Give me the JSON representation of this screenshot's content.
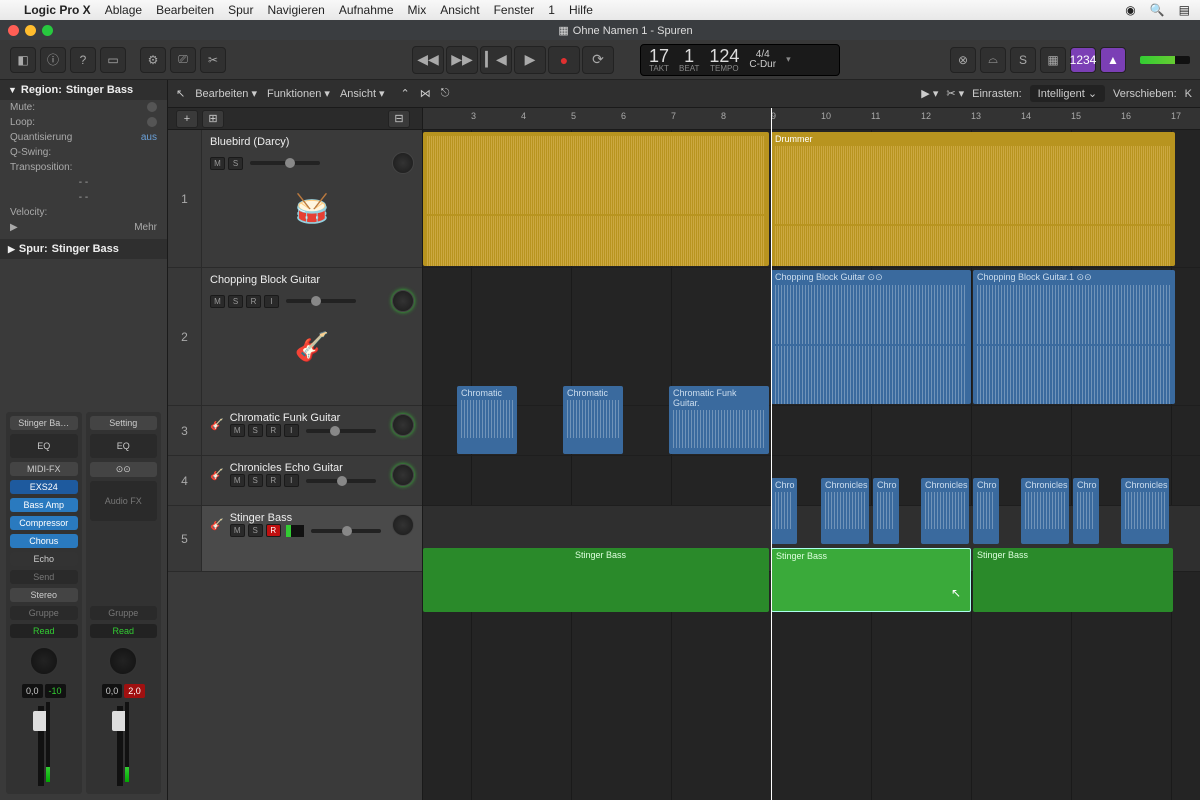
{
  "menubar": {
    "app": "Logic Pro X",
    "items": [
      "Ablage",
      "Bearbeiten",
      "Spur",
      "Navigieren",
      "Aufnahme",
      "Mix",
      "Ansicht",
      "Fenster",
      "1",
      "Hilfe"
    ]
  },
  "window_title": "Ohne Namen 1 - Spuren",
  "lcd": {
    "bars": "17",
    "beat": "1",
    "beat_label": "BEAT",
    "bars_label": "TAKT",
    "tempo": "124",
    "tempo_label": "TEMPO",
    "sig": "4/4",
    "key": "C-Dur"
  },
  "track_toolbar": {
    "menus": [
      "Bearbeiten",
      "Funktionen",
      "Ansicht"
    ],
    "snap_label": "Einrasten:",
    "snap_value": "Intelligent",
    "move_label": "Verschieben:",
    "move_value": "K"
  },
  "inspector": {
    "region_header": "Region:",
    "region_name": "Stinger Bass",
    "rows": [
      {
        "k": "Mute:",
        "v": ""
      },
      {
        "k": "Loop:",
        "v": ""
      },
      {
        "k": "Quantisierung",
        "v": "aus"
      },
      {
        "k": "Q-Swing:",
        "v": ""
      },
      {
        "k": "Transposition:",
        "v": ""
      },
      {
        "k": "-  -",
        "v": ""
      },
      {
        "k": "-  -",
        "v": ""
      },
      {
        "k": "Velocity:",
        "v": ""
      }
    ],
    "more": "Mehr",
    "track_header": "Spur:",
    "track_name": "Stinger Bass",
    "strip_a": {
      "name": "Stinger Ba…",
      "eq": "EQ",
      "midifx": "MIDI-FX",
      "inst": "EXS24",
      "fx": [
        "Bass Amp",
        "Compressor",
        "Chorus",
        "Echo"
      ],
      "send": "Send",
      "stereo": "Stereo",
      "gruppe": "Gruppe",
      "read": "Read",
      "pan": "0,0",
      "db": "-10"
    },
    "strip_b": {
      "setting": "Setting",
      "eq": "EQ",
      "link": "⊙⊙",
      "audiofx": "Audio FX",
      "gruppe": "Gruppe",
      "read": "Read",
      "pan": "0,0",
      "db": "2,0"
    }
  },
  "ruler_marks": [
    "3",
    "4",
    "5",
    "6",
    "7",
    "8",
    "9",
    "10",
    "11",
    "12",
    "13",
    "14",
    "15",
    "16",
    "17"
  ],
  "tracks": [
    {
      "num": "1",
      "name": "Bluebird (Darcy)",
      "btns": [
        "M",
        "S"
      ],
      "h": "h1",
      "img": "🥁"
    },
    {
      "num": "2",
      "name": "Chopping Block Guitar",
      "btns": [
        "M",
        "S",
        "R",
        "I"
      ],
      "h": "h2",
      "img": "🎸",
      "knob": "g"
    },
    {
      "num": "3",
      "name": "Chromatic Funk Guitar",
      "btns": [
        "M",
        "S",
        "R",
        "I"
      ],
      "h": "h3",
      "knob": "g"
    },
    {
      "num": "4",
      "name": "Chronicles Echo Guitar",
      "btns": [
        "M",
        "S",
        "R",
        "I"
      ],
      "h": "h4",
      "knob": "g"
    },
    {
      "num": "5",
      "name": "Stinger Bass",
      "btns": [
        "M",
        "S",
        "R"
      ],
      "h": "h5",
      "rec": true,
      "selected": true
    }
  ],
  "regions": {
    "drummer": "Drummer",
    "chop1": "Chopping Block Guitar ⊙⊙",
    "chop2": "Chopping Block Guitar.1 ⊙⊙",
    "chrom": "Chromatic",
    "chromfull": "Chromatic Funk Guitar.",
    "chron_s": "Chro",
    "chron": "Chronicles",
    "stinger": "Stinger Bass"
  },
  "master_btn": "1234"
}
